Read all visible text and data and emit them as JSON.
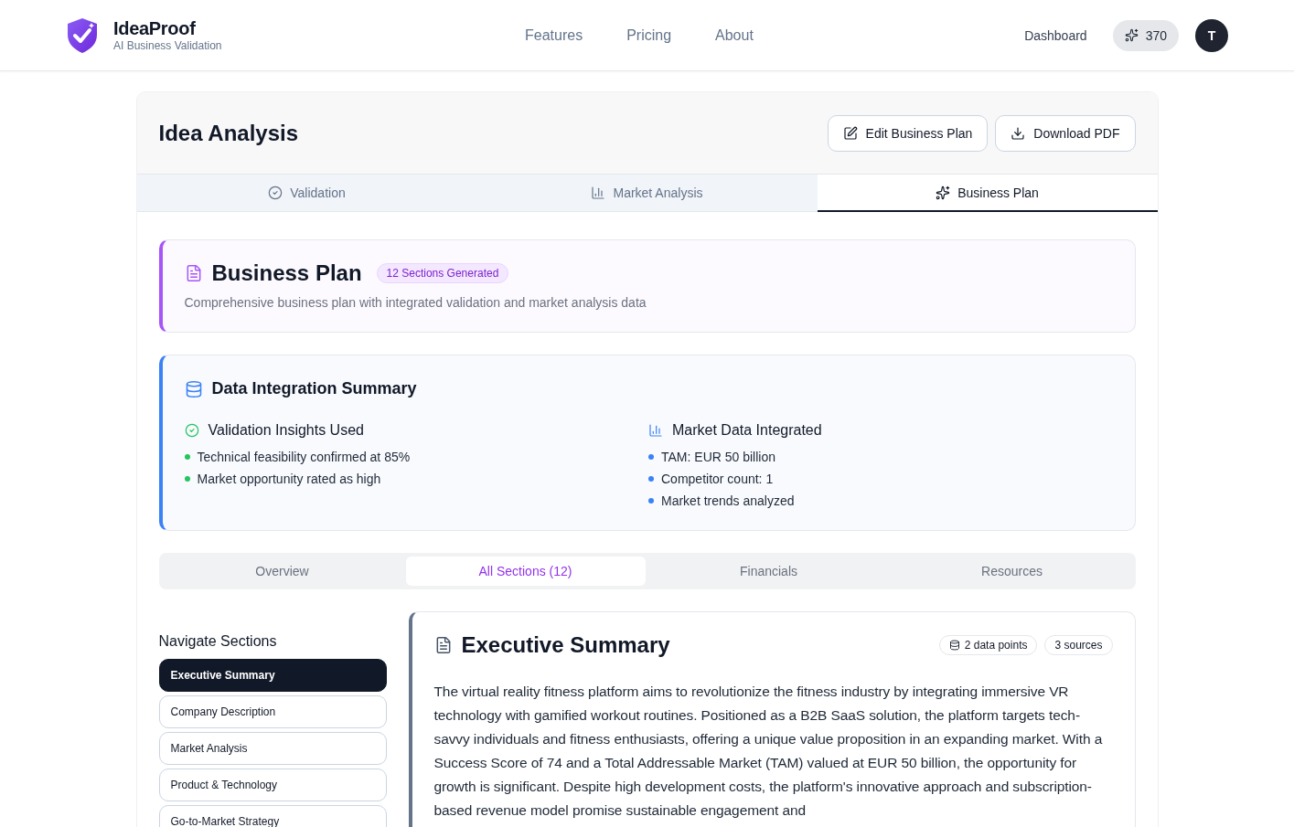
{
  "header": {
    "brand": {
      "name": "IdeaProof",
      "tagline": "AI Business Validation"
    },
    "nav": [
      {
        "label": "Features"
      },
      {
        "label": "Pricing"
      },
      {
        "label": "About"
      }
    ],
    "dashboard": "Dashboard",
    "credits": "370",
    "avatar": "T"
  },
  "page": {
    "title": "Idea Analysis",
    "actions": [
      {
        "label": "Edit Business Plan",
        "kind": "edit"
      },
      {
        "label": "Download PDF",
        "kind": "download"
      }
    ],
    "tabs": [
      {
        "label": "Validation",
        "kind": "validation",
        "selected": false
      },
      {
        "label": "Market Analysis",
        "kind": "market",
        "selected": false
      },
      {
        "label": "Business Plan",
        "kind": "plan",
        "selected": true
      }
    ]
  },
  "plan_header": {
    "title": "Business Plan",
    "badge": "12 Sections Generated",
    "description": "Comprehensive business plan with integrated validation and market analysis data"
  },
  "integration": {
    "title": "Data Integration Summary",
    "columns": [
      {
        "title": "Validation Insights Used",
        "kind": "validation",
        "color": "#22c55e",
        "items": [
          "Technical feasibility confirmed at 85%",
          "Market opportunity rated as high"
        ]
      },
      {
        "title": "Market Data Integrated",
        "kind": "market",
        "color": "#3b82f6",
        "items": [
          "TAM: EUR 50 billion",
          "Competitor count: 1",
          "Market trends analyzed"
        ]
      }
    ]
  },
  "sub_tabs": [
    {
      "label": "Overview",
      "selected": false
    },
    {
      "label": "All Sections (12)",
      "selected": true
    },
    {
      "label": "Financials",
      "selected": false
    },
    {
      "label": "Resources",
      "selected": false
    }
  ],
  "sidebar": {
    "title": "Navigate Sections",
    "items": [
      {
        "label": "Executive Summary",
        "selected": true
      },
      {
        "label": "Company Description",
        "selected": false
      },
      {
        "label": "Market Analysis",
        "selected": false
      },
      {
        "label": "Product & Technology",
        "selected": false
      },
      {
        "label": "Go-to-Market Strategy",
        "selected": false
      }
    ]
  },
  "section": {
    "title": "Executive Summary",
    "badges": [
      {
        "label": "2 data points",
        "kind": "data"
      },
      {
        "label": "3 sources",
        "kind": "sources"
      }
    ],
    "body": "The virtual reality fitness platform aims to revolutionize the fitness industry by integrating immersive VR technology with gamified workout routines. Positioned as a B2B SaaS solution, the platform targets tech-savvy individuals and fitness enthusiasts, offering a unique value proposition in an expanding market. With a Success Score of 74 and a Total Addressable Market (TAM) valued at EUR 50 billion, the opportunity for growth is significant. Despite high development costs, the platform's innovative approach and subscription-based revenue model promise sustainable engagement and"
  }
}
